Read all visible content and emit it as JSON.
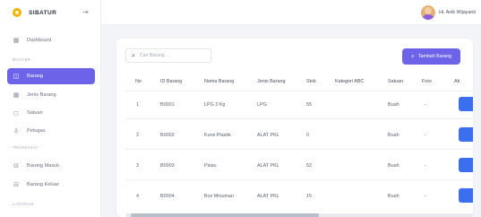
{
  "brand": {
    "name": "SIBATUR"
  },
  "user": {
    "greeting": "Hi, Anik Wijayanti"
  },
  "sidebar": {
    "items": [
      {
        "label": "Dashboard",
        "icon": "dashboard-icon"
      },
      {
        "label": "Barang",
        "icon": "box-icon",
        "active": true
      },
      {
        "label": "Jenis Barang",
        "icon": "grid-icon"
      },
      {
        "label": "Satuan",
        "icon": "tag-icon"
      },
      {
        "label": "Petugas",
        "icon": "user-icon"
      },
      {
        "label": "Barang Masuk",
        "icon": "inbox-in-icon"
      },
      {
        "label": "Barang Keluar",
        "icon": "inbox-out-icon"
      }
    ],
    "sections": [
      "MASTER",
      "TRANSAKSI",
      "LAPORAN"
    ]
  },
  "toolbar": {
    "search_placeholder": "Cari Barang ...",
    "add_label": "Tambah Barang"
  },
  "table": {
    "headers": [
      "No",
      "ID Barang",
      "Nama Barang",
      "Jenis Barang",
      "Stok",
      "Kategori ABC",
      "Satuan",
      "Foto",
      "Ak"
    ],
    "rows": [
      [
        "1",
        "B0001",
        "LPG 3 Kg",
        "LPG",
        "55",
        "",
        "Buah",
        "-"
      ],
      [
        "2",
        "B0002",
        "Kursi Plastik",
        "ALAT PKL",
        "0",
        "",
        "Buah",
        "-"
      ],
      [
        "3",
        "B0003",
        "Pisau",
        "ALAT PKL",
        "52",
        "",
        "Buah",
        "-"
      ],
      [
        "4",
        "B0004",
        "Box Minuman",
        "ALAT PKL",
        "15",
        "",
        "Buah",
        "-"
      ]
    ]
  },
  "colors": {
    "accent": "#6c63e9",
    "action": "#3b6ff0"
  }
}
